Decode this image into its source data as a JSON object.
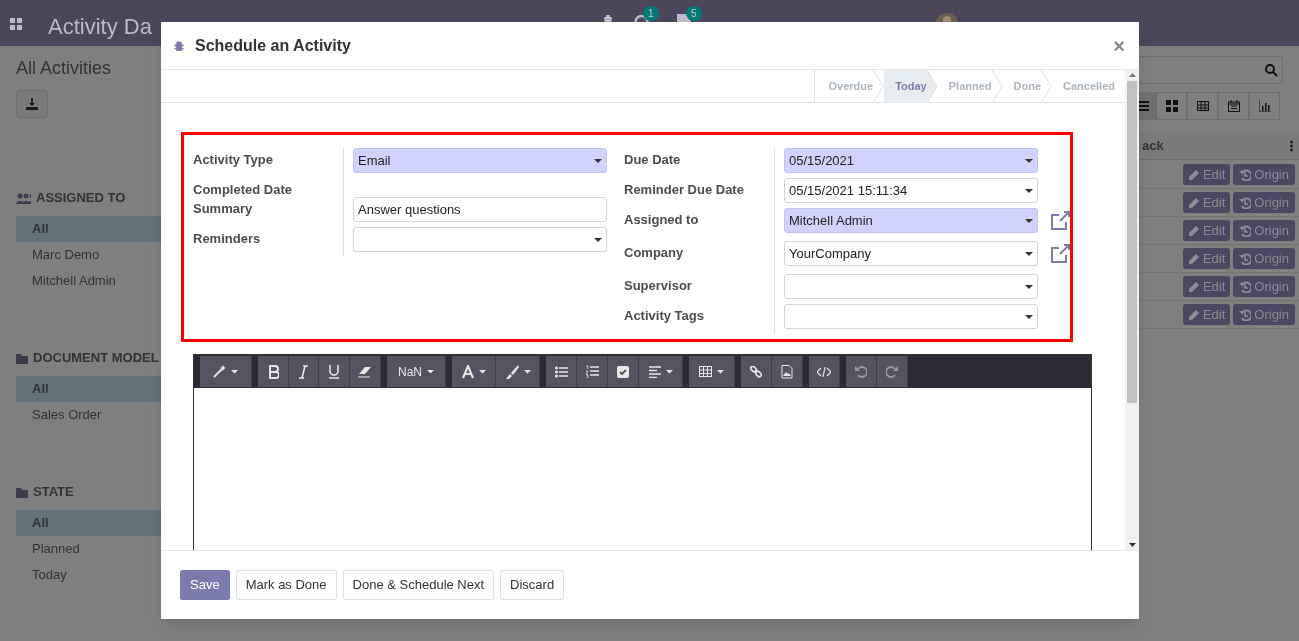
{
  "navbar": {
    "app_title": "Activity Da",
    "activity_count": "1",
    "message_count": "5"
  },
  "page": {
    "title": "All Activities"
  },
  "sidebar": [
    {
      "title": "ASSIGNED TO",
      "items": [
        {
          "label": "All",
          "selected": true
        },
        {
          "label": "Marc Demo",
          "selected": false
        },
        {
          "label": "Mitchell Admin",
          "selected": false
        }
      ]
    },
    {
      "title": "DOCUMENT MODEL",
      "items": [
        {
          "label": "All",
          "selected": true
        },
        {
          "label": "Sales Order",
          "selected": false
        }
      ]
    },
    {
      "title": "STATE",
      "items": [
        {
          "label": "All",
          "selected": true
        },
        {
          "label": "Planned",
          "selected": false
        },
        {
          "label": "Today",
          "selected": false
        }
      ]
    }
  ],
  "views": [
    {
      "selected": true
    },
    {
      "selected": false
    },
    {
      "selected": false
    },
    {
      "selected": false
    },
    {
      "selected": false
    }
  ],
  "table": {
    "column_heading": "ack",
    "rows": [
      {
        "edit": "Edit",
        "origin": "Origin"
      },
      {
        "edit": "Edit",
        "origin": "Origin"
      },
      {
        "edit": "Edit",
        "origin": "Origin"
      },
      {
        "edit": "Edit",
        "origin": "Origin"
      },
      {
        "edit": "Edit",
        "origin": "Origin"
      },
      {
        "edit": "Edit",
        "origin": "Origin"
      }
    ]
  },
  "dialog": {
    "title": "Schedule an Activity",
    "close_label": "×",
    "stages": [
      {
        "label": "Overdue",
        "selected": false
      },
      {
        "label": "Today",
        "selected": true
      },
      {
        "label": "Planned",
        "selected": false
      },
      {
        "label": "Done",
        "selected": false
      },
      {
        "label": "Cancelled",
        "selected": false
      }
    ],
    "left_fields": [
      {
        "label": "Activity Type",
        "kind": "select",
        "value": "Email",
        "required": true
      },
      {
        "label": "Completed Date",
        "kind": "none"
      },
      {
        "label": "Summary",
        "kind": "text",
        "value": "Answer questions",
        "required": false
      },
      {
        "label": "Reminders",
        "kind": "select",
        "required": false
      }
    ],
    "right_fields": [
      {
        "label": "Due Date",
        "kind": "select",
        "value": "05/15/2021",
        "required": true
      },
      {
        "label": "Reminder Due Date",
        "kind": "select",
        "value": "05/15/2021 15:11:34",
        "required": false
      },
      {
        "label": "Assigned to",
        "kind": "select",
        "value": "Mitchell Admin",
        "required": true,
        "external_link": true
      },
      {
        "label": "Company",
        "kind": "select",
        "value": "YourCompany",
        "required": false,
        "external_link": true
      },
      {
        "label": "Supervisor",
        "kind": "select",
        "required": false
      },
      {
        "label": "Activity Tags",
        "kind": "select",
        "required": false
      }
    ],
    "editor": {
      "font_size": "NaN"
    },
    "buttons": [
      {
        "label": "Save",
        "primary": true
      },
      {
        "label": "Mark as Done",
        "primary": false
      },
      {
        "label": "Done & Schedule Next",
        "primary": false
      },
      {
        "label": "Discard",
        "primary": false
      }
    ]
  }
}
